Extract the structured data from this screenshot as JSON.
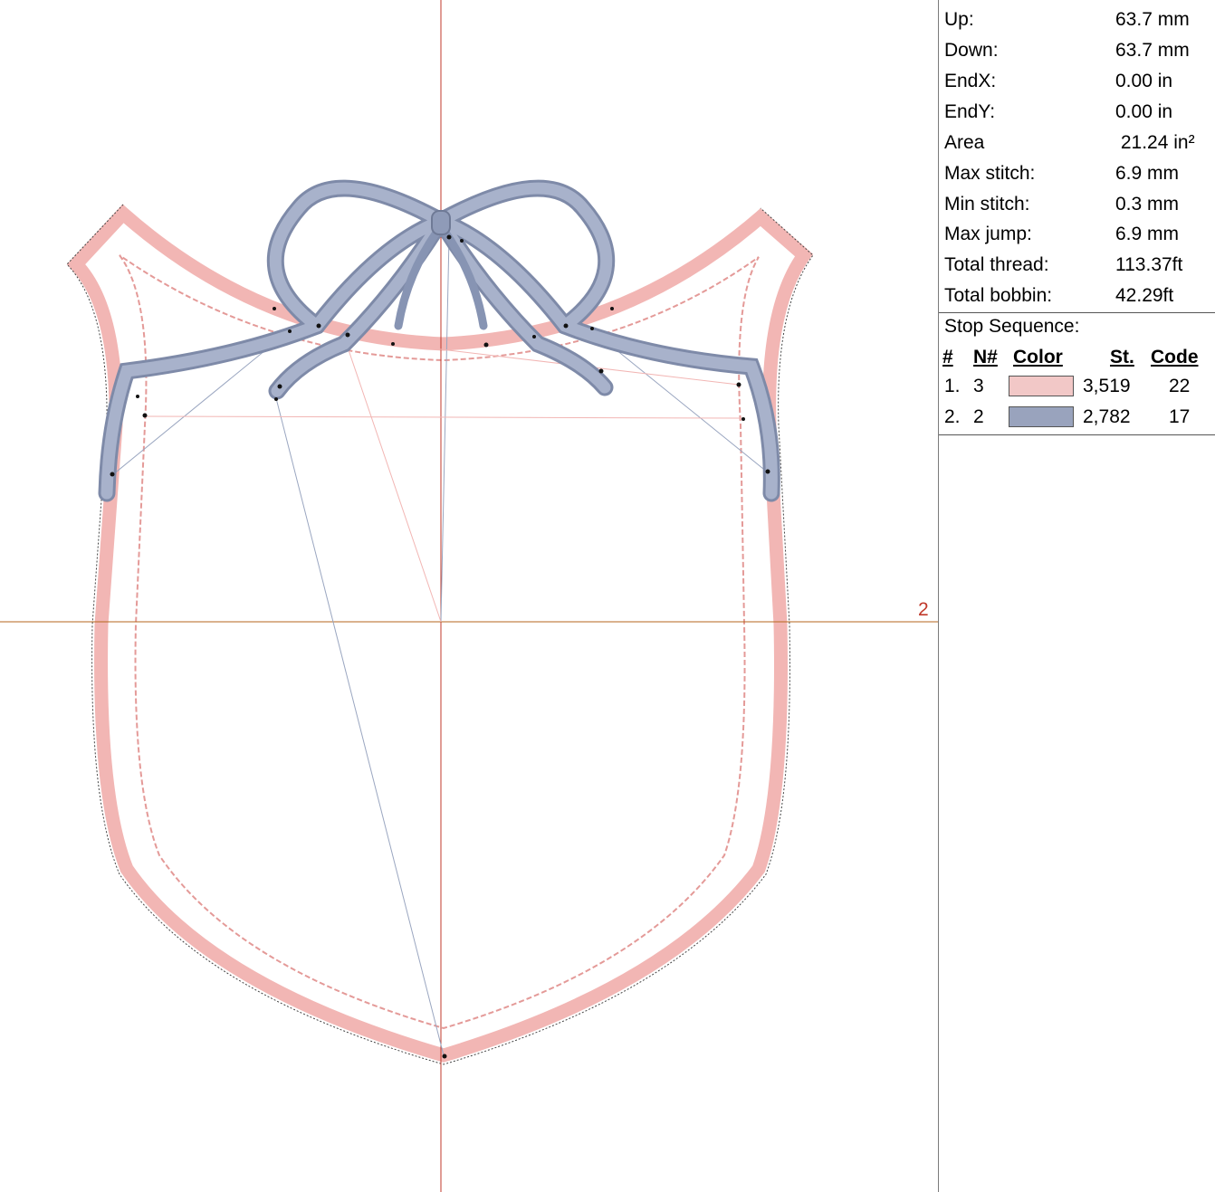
{
  "canvas": {
    "axis_label": "2",
    "colors": {
      "outline": "#f2b6b4",
      "ribbon": "#8f9bb8",
      "crosshair": "#c0392b",
      "jump": "#9aa6c0"
    }
  },
  "panel": {
    "stats": [
      {
        "label": "Up:",
        "value": "63.7 mm"
      },
      {
        "label": "Down:",
        "value": "63.7 mm"
      },
      {
        "label": "EndX:",
        "value": "0.00 in"
      },
      {
        "label": "EndY:",
        "value": "0.00 in"
      },
      {
        "label": "Area",
        "value": " 21.24 in²"
      },
      {
        "label": "Max stitch:",
        "value": "6.9 mm"
      },
      {
        "label": "Min stitch:",
        "value": "0.3 mm"
      },
      {
        "label": "Max jump:",
        "value": "6.9 mm"
      },
      {
        "label": "Total thread:",
        "value": "113.37ft"
      },
      {
        "label": "Total bobbin:",
        "value": "42.29ft"
      }
    ],
    "stop_sequence": {
      "title": "Stop Sequence:",
      "headers": {
        "index": "#",
        "needle": "N#",
        "color": "Color",
        "stitches": "St.",
        "code": "Code"
      },
      "rows": [
        {
          "index": "1.",
          "needle": "3",
          "color": "#f2c8c7",
          "stitches": "3,519",
          "code": "22"
        },
        {
          "index": "2.",
          "needle": "2",
          "color": "#99a3bd",
          "stitches": "2,782",
          "code": "17"
        }
      ]
    }
  }
}
